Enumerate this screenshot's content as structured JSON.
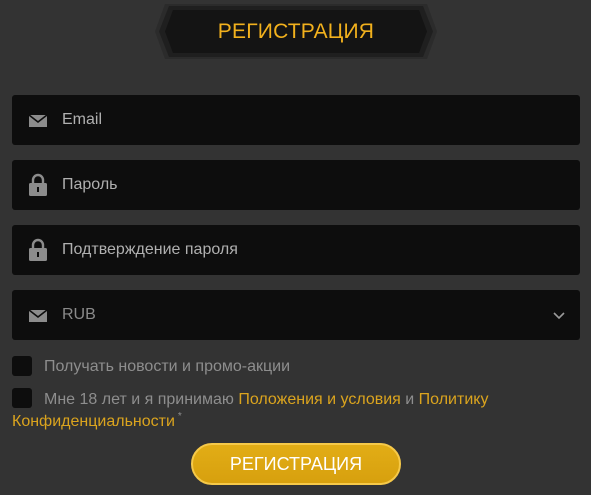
{
  "header": {
    "title": "РЕГИСТРАЦИЯ"
  },
  "form": {
    "email": {
      "placeholder": "Email",
      "icon": "envelope-icon"
    },
    "password": {
      "placeholder": "Пароль",
      "icon": "lock-icon"
    },
    "password_confirm": {
      "placeholder": "Подтверждение пароля",
      "icon": "lock-icon"
    },
    "currency": {
      "value": "RUB",
      "icon": "envelope-icon",
      "dropdown_icon": "chevron-down-icon"
    }
  },
  "checkboxes": {
    "newsletter": {
      "label": "Получать новости и промо-акции",
      "checked": false
    },
    "terms": {
      "text_before": "Мне 18 лет и я принимаю",
      "terms_link": "Положения и условия",
      "text_and": "и",
      "privacy_link_part1": "Политику",
      "privacy_link_part2": "Конфиденциальности",
      "required_mark": "*",
      "checked": false
    }
  },
  "submit": {
    "label": "РЕГИСТРАЦИЯ"
  },
  "colors": {
    "background": "#333333",
    "field_background": "#0d0d0d",
    "accent": "#f2b11d",
    "button": "#dca513"
  }
}
